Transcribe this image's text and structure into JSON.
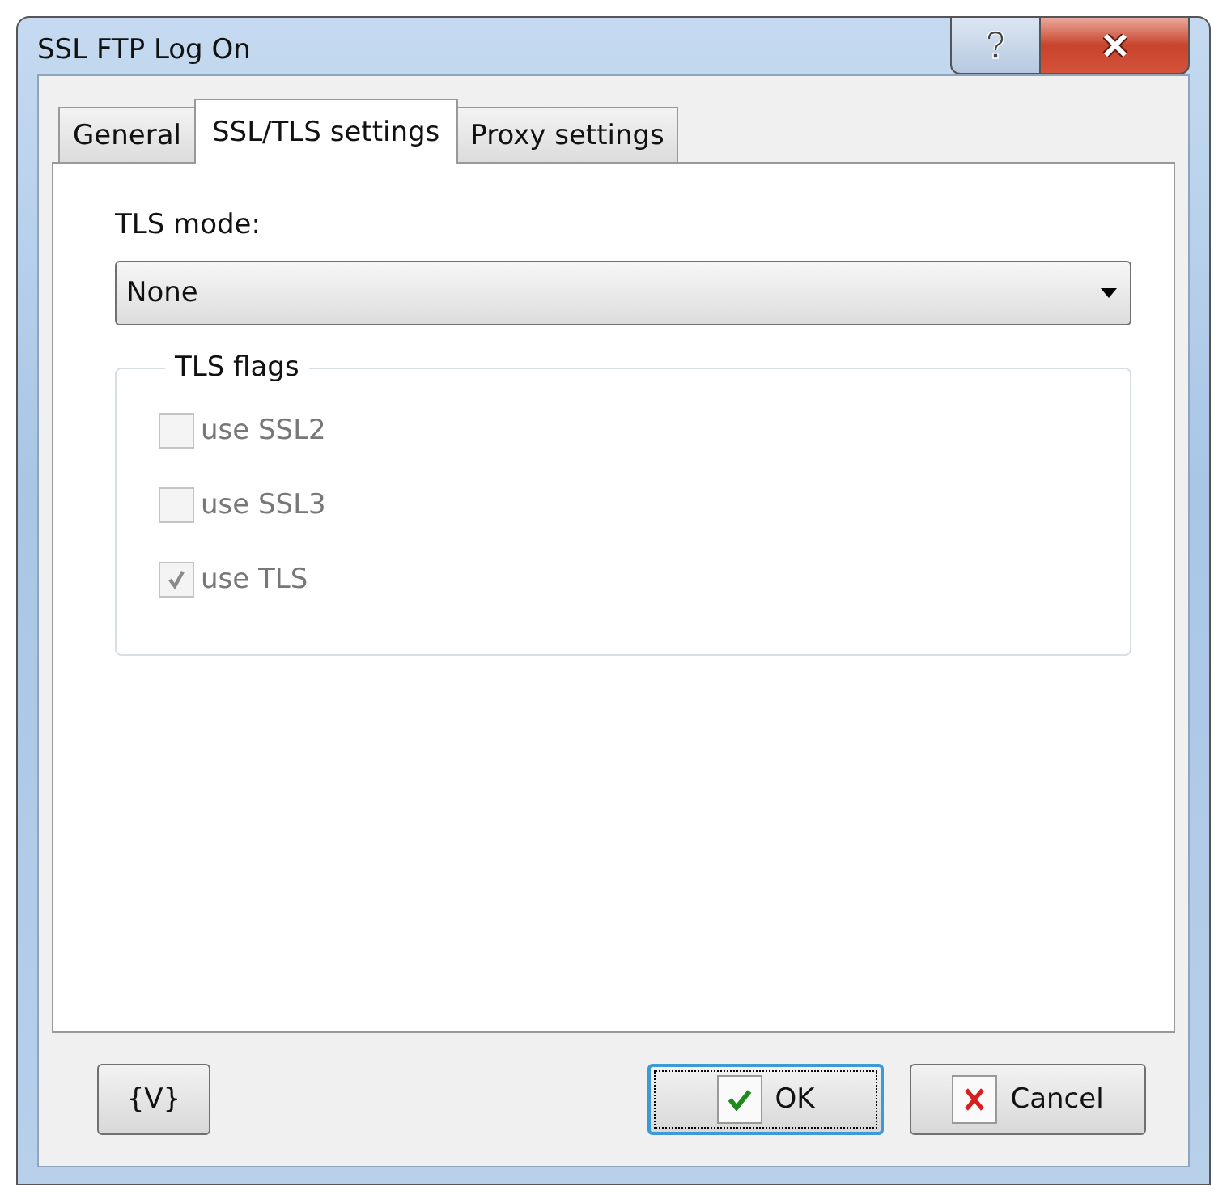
{
  "window": {
    "title": "SSL FTP Log On"
  },
  "tabs": [
    {
      "label": "General",
      "selected": false
    },
    {
      "label": "SSL/TLS settings",
      "selected": true
    },
    {
      "label": "Proxy settings",
      "selected": false
    }
  ],
  "tls_mode": {
    "label": "TLS mode:",
    "value": "None"
  },
  "tls_flags": {
    "title": "TLS flags",
    "options": [
      {
        "label": "use SSL2",
        "checked": false,
        "disabled": true
      },
      {
        "label": "use SSL3",
        "checked": false,
        "disabled": true
      },
      {
        "label": "use TLS",
        "checked": true,
        "disabled": true
      }
    ]
  },
  "buttons": [
    {
      "kind": "variables",
      "label": "{V}",
      "default": false
    },
    {
      "kind": "ok",
      "label": "OK",
      "default": true
    },
    {
      "kind": "cancel",
      "label": "Cancel",
      "default": false
    }
  ]
}
